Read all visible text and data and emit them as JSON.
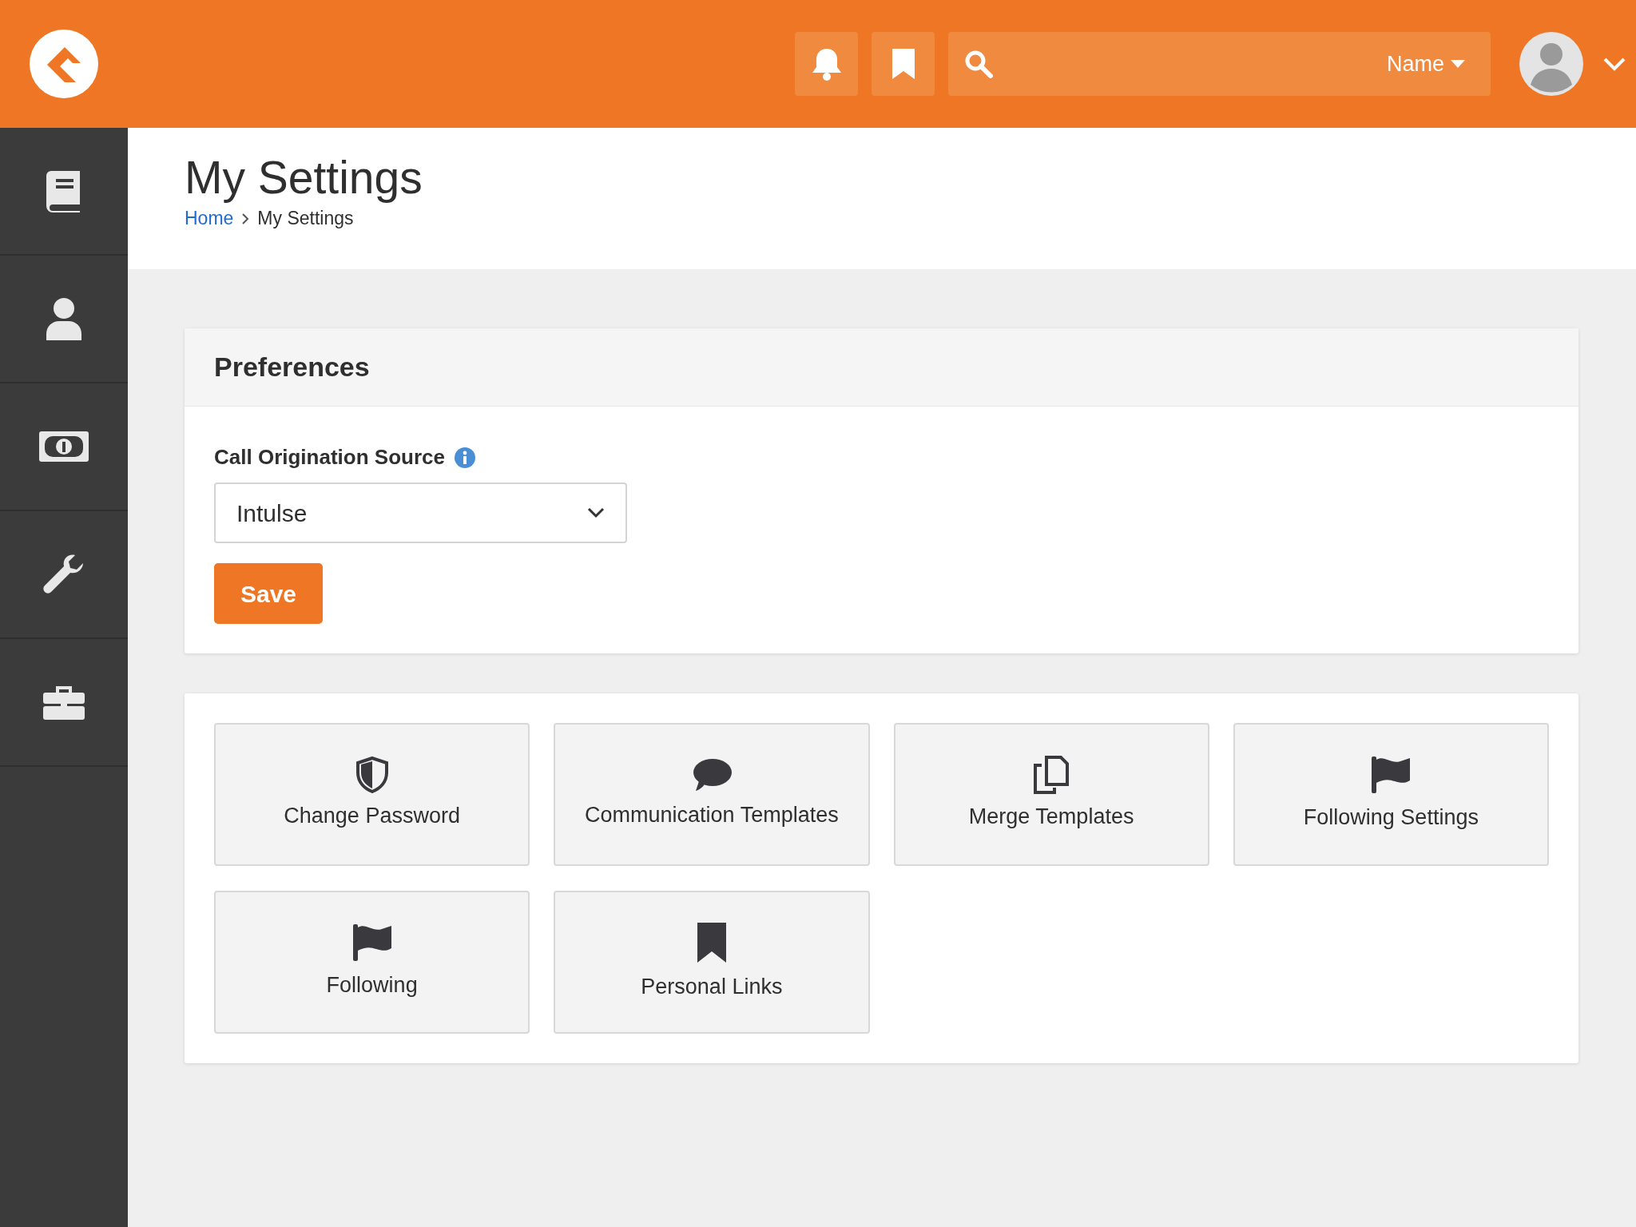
{
  "header": {
    "search_filter": "Name"
  },
  "sidebar": [
    {
      "kind": "book"
    },
    {
      "kind": "person"
    },
    {
      "kind": "money"
    },
    {
      "kind": "wrench"
    },
    {
      "kind": "briefcase"
    }
  ],
  "page_title": "My Settings",
  "breadcrumb": [
    {
      "label": "Home",
      "link": true
    },
    {
      "label": "My Settings",
      "link": false
    }
  ],
  "preferences": {
    "title": "Preferences",
    "field_label": "Call Origination Source",
    "select_value": "Intulse",
    "save_button": "Save"
  },
  "tiles": [
    {
      "label": "Change Password",
      "kind": "shield"
    },
    {
      "label": "Communication Templates",
      "kind": "comment"
    },
    {
      "label": "Merge Templates",
      "kind": "copy"
    },
    {
      "label": "Following Settings",
      "kind": "flag"
    },
    {
      "label": "Following",
      "kind": "flag"
    },
    {
      "label": "Personal Links",
      "kind": "bookmark"
    }
  ]
}
